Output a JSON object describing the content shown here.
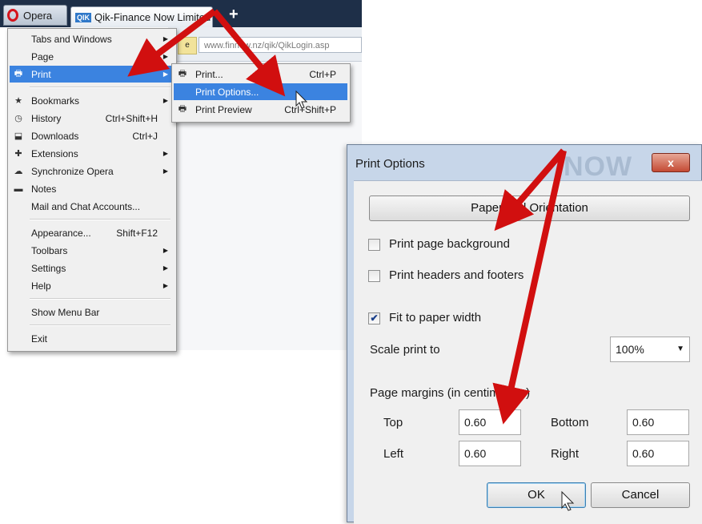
{
  "browser": {
    "app_button_label": "Opera",
    "tab_favicon_text": "QIK",
    "tab_title": "Qik-Finance Now Limited",
    "new_tab_label": "+",
    "address_left_label": "e",
    "address_url": "www.finnow.nz/qik/QikLogin.asp"
  },
  "main_menu": {
    "items": [
      {
        "label": "Tabs and Windows",
        "shortcut": "",
        "submenu": true,
        "icon": ""
      },
      {
        "label": "Page",
        "shortcut": "",
        "submenu": true,
        "icon": ""
      },
      {
        "label": "Print",
        "shortcut": "",
        "submenu": true,
        "icon": "printer-icon",
        "highlighted": true
      },
      {
        "label": "Bookmarks",
        "shortcut": "",
        "submenu": true,
        "icon": "star-icon"
      },
      {
        "label": "History",
        "shortcut": "Ctrl+Shift+H",
        "submenu": false,
        "icon": "clock-icon"
      },
      {
        "label": "Downloads",
        "shortcut": "Ctrl+J",
        "submenu": false,
        "icon": "download-icon"
      },
      {
        "label": "Extensions",
        "shortcut": "",
        "submenu": true,
        "icon": "puzzle-icon"
      },
      {
        "label": "Synchronize Opera",
        "shortcut": "",
        "submenu": true,
        "icon": "cloud-icon"
      },
      {
        "label": "Notes",
        "shortcut": "",
        "submenu": false,
        "icon": "notes-icon"
      },
      {
        "label": "Mail and Chat Accounts...",
        "shortcut": "",
        "submenu": false,
        "icon": ""
      },
      {
        "label": "Appearance...",
        "shortcut": "Shift+F12",
        "submenu": false,
        "icon": ""
      },
      {
        "label": "Toolbars",
        "shortcut": "",
        "submenu": true,
        "icon": ""
      },
      {
        "label": "Settings",
        "shortcut": "",
        "submenu": true,
        "icon": ""
      },
      {
        "label": "Help",
        "shortcut": "",
        "submenu": true,
        "icon": ""
      },
      {
        "label": "Show Menu Bar",
        "shortcut": "",
        "submenu": false,
        "icon": ""
      },
      {
        "label": "Exit",
        "shortcut": "",
        "submenu": false,
        "icon": ""
      }
    ]
  },
  "print_submenu": {
    "items": [
      {
        "label": "Print...",
        "shortcut": "Ctrl+P",
        "icon": "printer-icon"
      },
      {
        "label": "Print Options...",
        "shortcut": "",
        "icon": "",
        "highlighted": true
      },
      {
        "label": "Print Preview",
        "shortcut": "Ctrl+Shift+P",
        "icon": "print-preview-icon"
      }
    ]
  },
  "dialog": {
    "title": "Print Options",
    "watermark": "NOW",
    "close_label": "x",
    "paper_button": "Paper and Orientation",
    "print_background": {
      "label": "Print page background",
      "checked": false
    },
    "print_headers": {
      "label": "Print headers and footers",
      "checked": false
    },
    "fit_width": {
      "label": "Fit to paper width",
      "checked": true
    },
    "check_mark": "✔",
    "scale_label": "Scale print to",
    "scale_value": "100%",
    "margins_label": "Page margins (in centimeters)",
    "top_label": "Top",
    "top_value": "0.60",
    "bottom_label": "Bottom",
    "bottom_value": "0.60",
    "left_label": "Left",
    "left_value": "0.60",
    "right_label": "Right",
    "right_value": "0.60",
    "ok_label": "OK",
    "cancel_label": "Cancel"
  },
  "colors": {
    "arrow": "#d10f0f",
    "menu_highlight": "#3b83e0",
    "tabbar": "#1e2f48"
  }
}
